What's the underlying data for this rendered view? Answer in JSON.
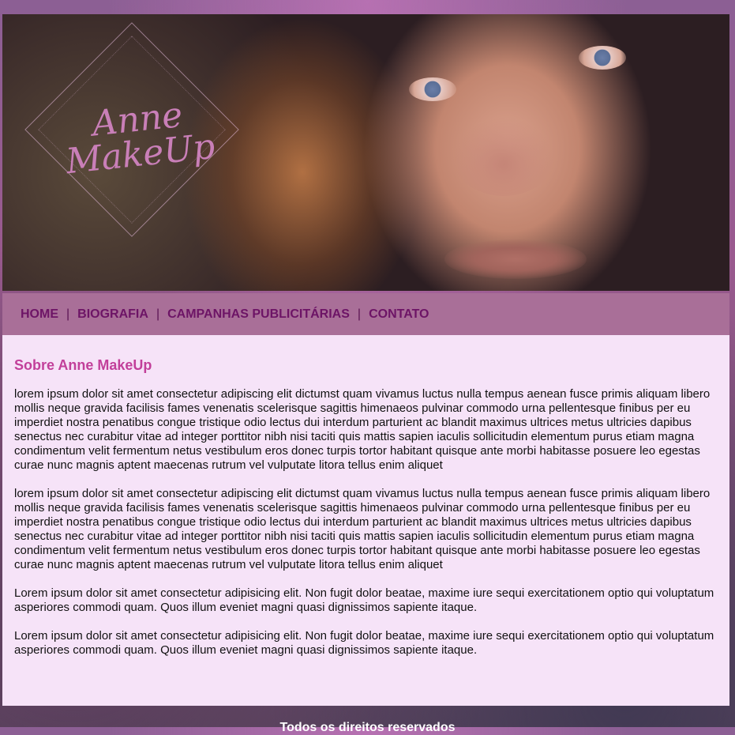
{
  "hero": {
    "logo_line1": "Anne",
    "logo_line2": "MakeUp"
  },
  "nav": {
    "items": [
      {
        "label": "HOME"
      },
      {
        "label": "BIOGRAFIA"
      },
      {
        "label": "CAMPANHAS PUBLICITÁRIAS"
      },
      {
        "label": "CONTATO"
      }
    ],
    "separator": "|"
  },
  "content": {
    "title": "Sobre Anne MakeUp",
    "paragraphs": [
      "lorem ipsum dolor sit amet consectetur adipiscing elit dictumst quam vivamus luctus nulla tempus aenean fusce primis aliquam libero mollis neque gravida facilisis fames venenatis scelerisque sagittis himenaeos pulvinar commodo urna pellentesque finibus per eu imperdiet nostra penatibus congue tristique odio lectus dui interdum parturient ac blandit maximus ultrices metus ultricies dapibus senectus nec curabitur vitae ad integer porttitor nibh nisi taciti quis mattis sapien iaculis sollicitudin elementum purus etiam magna condimentum velit fermentum netus vestibulum eros donec turpis tortor habitant quisque ante morbi habitasse posuere leo egestas curae nunc magnis aptent maecenas rutrum vel vulputate litora tellus enim aliquet",
      "lorem ipsum dolor sit amet consectetur adipiscing elit dictumst quam vivamus luctus nulla tempus aenean fusce primis aliquam libero mollis neque gravida facilisis fames venenatis scelerisque sagittis himenaeos pulvinar commodo urna pellentesque finibus per eu imperdiet nostra penatibus congue tristique odio lectus dui interdum parturient ac blandit maximus ultrices metus ultricies dapibus senectus nec curabitur vitae ad integer porttitor nibh nisi taciti quis mattis sapien iaculis sollicitudin elementum purus etiam magna condimentum velit fermentum netus vestibulum eros donec turpis tortor habitant quisque ante morbi habitasse posuere leo egestas curae nunc magnis aptent maecenas rutrum vel vulputate litora tellus enim aliquet",
      "Lorem ipsum dolor sit amet consectetur adipisicing elit. Non fugit dolor beatae, maxime iure sequi exercitationem optio qui voluptatum asperiores commodi quam. Quos illum eveniet magni quasi dignissimos sapiente itaque.",
      "Lorem ipsum dolor sit amet consectetur adipisicing elit. Non fugit dolor beatae, maxime iure sequi exercitationem optio qui voluptatum asperiores commodi quam. Quos illum eveniet magni quasi dignissimos sapiente itaque."
    ]
  },
  "footer": {
    "text": "Todos os direitos reservados"
  }
}
